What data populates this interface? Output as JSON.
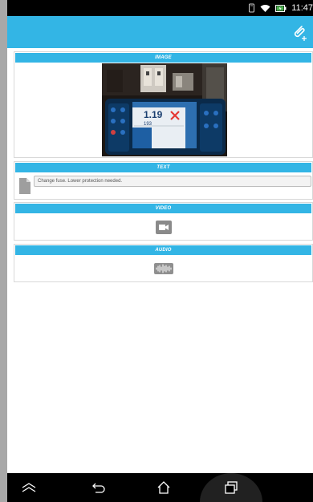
{
  "status_bar": {
    "time": "11:47",
    "icons": [
      "vibrate-icon",
      "wifi-icon",
      "battery-charging-icon"
    ]
  },
  "action_bar": {
    "action_icon": "attachment-add-icon"
  },
  "sections": {
    "image": {
      "title": "IMAGE",
      "thumbnail": "photo-of-meter-and-fuse-box"
    },
    "text": {
      "title": "TEXT",
      "note": "Change fuse. Lower protection needed.",
      "icon": "document-icon"
    },
    "video": {
      "title": "VIDEO",
      "icon": "video-camera-icon"
    },
    "audio": {
      "title": "AUDIO",
      "icon": "audio-waveform-icon"
    }
  },
  "photo_content": {
    "meter_reading_main": "1.19",
    "meter_reading_sub": "193"
  },
  "navigation": {
    "buttons": [
      "collapse-icon",
      "back-icon",
      "home-icon",
      "recent-apps-icon"
    ]
  },
  "colors": {
    "accent": "#33b5e5",
    "nav_background": "#000000",
    "card_border": "#d8d8d8"
  }
}
